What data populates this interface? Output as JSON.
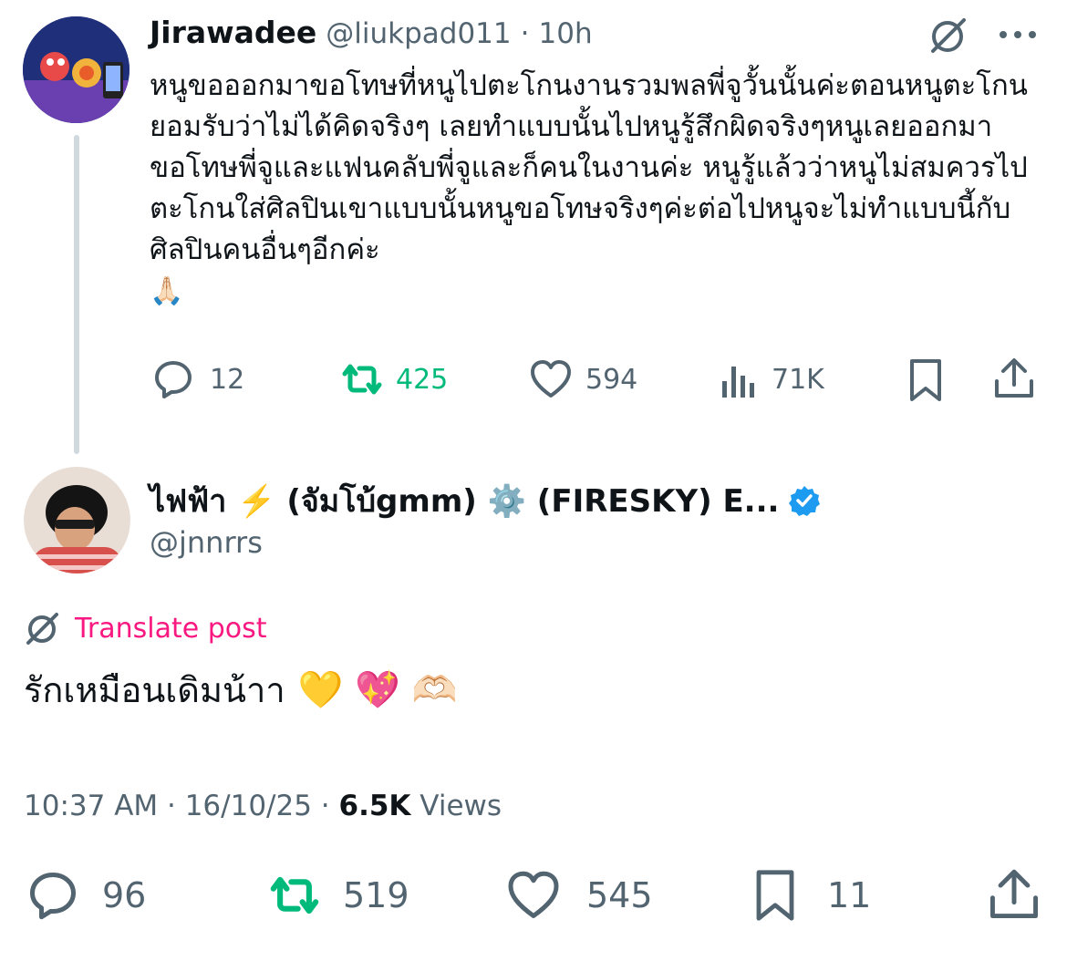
{
  "reply_tweet": {
    "author_name": "Jirawadee",
    "handle": "@liukpad011",
    "separator": "·",
    "time": "10h",
    "body": "หนูขอออกมาขอโทษที่หนูไปตะโกนงานรวมพลพี่จูวั้นนั้นค่ะตอนหนูตะโกนยอมรับว่าไม่ได้คิดจริงๆ เลยทำแบบนั้นไปหนูรู้สึกผิดจริงๆหนูเลยออกมาขอโทษพี่จูและแฟนคลับพี่จูและก็คนในงานค่ะ หนูรู้แล้วว่าหนูไม่สมควรไปตะโกนใส่ศิลปินเขาแบบนั้นหนูขอโทษจริงๆค่ะต่อไปหนูจะไม่ทำแบบนี้กับศิลปินคนอื่นๆอีกค่ะ",
    "body_emoji": "🙏🏻",
    "stats": {
      "replies": "12",
      "reposts": "425",
      "likes": "594",
      "views": "71K"
    }
  },
  "main_tweet": {
    "author_name": "ไฟฟ้า ⚡️ (จัมโบ้gmm) ⚙️ (FIRESKY) E...",
    "handle": "@jnnrrs",
    "translate_label": "Translate post",
    "body": "รักเหมือนเดิมน้าา",
    "body_emojis": "💛 💖 🫶🏻",
    "timestamp": "10:37 AM · 16/10/25 · ",
    "views_count": "6.5K",
    "views_label": " Views",
    "stats": {
      "replies": "96",
      "reposts": "519",
      "likes": "545",
      "bookmarks": "11"
    }
  },
  "colors": {
    "text_primary": "#0f1419",
    "text_secondary": "#536471",
    "repost_active": "#00ba7c",
    "translate": "#f91880",
    "verified": "#1d9bf0"
  },
  "icons": [
    "grok-icon",
    "more-icon",
    "reply-icon",
    "repost-icon",
    "like-icon",
    "views-icon",
    "bookmark-icon",
    "share-icon",
    "verified-badge-icon",
    "translate-icon"
  ]
}
